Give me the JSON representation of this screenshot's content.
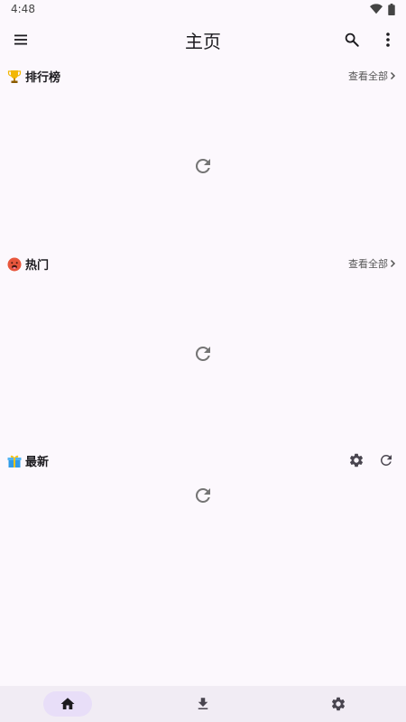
{
  "status_bar": {
    "time": "4:48",
    "icons": [
      "wifi-icon",
      "battery-icon"
    ]
  },
  "app_bar": {
    "title": "主页",
    "left_icon": "menu-icon",
    "right_icons": [
      "search-icon",
      "more-vert-icon"
    ]
  },
  "sections": [
    {
      "title": "排行榜",
      "icon": "trophy-icon",
      "view_all_label": "查看全部",
      "content_icon": "refresh-icon"
    },
    {
      "title": "热门",
      "icon": "hot-face-icon",
      "view_all_label": "查看全部",
      "content_icon": "refresh-icon"
    },
    {
      "title": "最新",
      "icon": "gift-icon",
      "actions": [
        "settings-icon",
        "refresh-icon"
      ],
      "content_icon": "refresh-icon"
    }
  ],
  "bottom_nav": {
    "items": [
      {
        "icon": "home-icon",
        "active": true
      },
      {
        "icon": "download-icon",
        "active": false
      },
      {
        "icon": "settings-icon",
        "active": false
      }
    ]
  },
  "colors": {
    "background": "#fcf8fd",
    "active_nav_pill": "#e8def8",
    "bottom_nav_bg": "#f1ecf4",
    "icon": "#49454f"
  }
}
